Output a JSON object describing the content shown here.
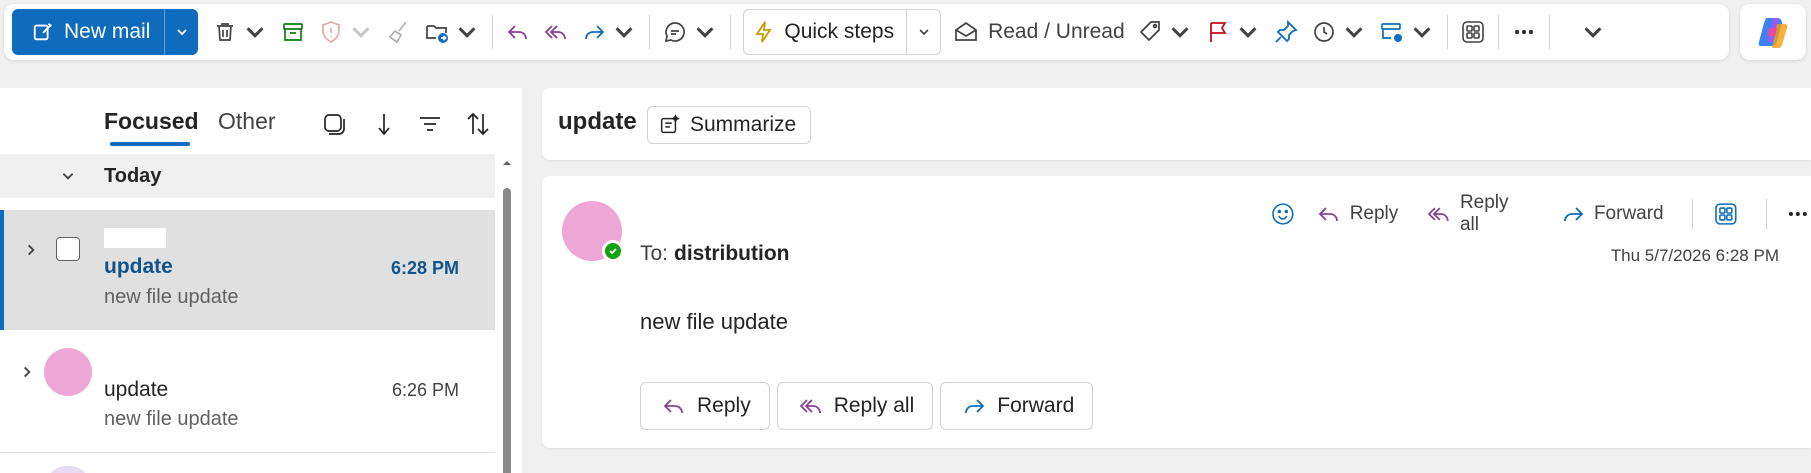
{
  "ribbon": {
    "new_mail_label": "New mail",
    "quick_steps_label": "Quick steps",
    "read_unread_label": "Read / Unread"
  },
  "list": {
    "tab_focused": "Focused",
    "tab_other": "Other",
    "group_today": "Today",
    "items": [
      {
        "subject": "update",
        "preview": "new file update",
        "time": "6:28 PM",
        "selected": true
      },
      {
        "subject": "update",
        "preview": "new file update",
        "time": "6:26 PM",
        "selected": false
      }
    ]
  },
  "reading": {
    "subject": "update",
    "summarize_label": "Summarize",
    "reply_label": "Reply",
    "reply_all_label": "Reply all",
    "forward_label": "Forward",
    "to_prefix": "To:",
    "to_name": "distribution",
    "date": "Thu 5/7/2026 6:28 PM",
    "body": "new file update"
  },
  "colors": {
    "accent": "#0f6cbd",
    "avatar": "#eda6d6",
    "presence": "#13a10e"
  }
}
